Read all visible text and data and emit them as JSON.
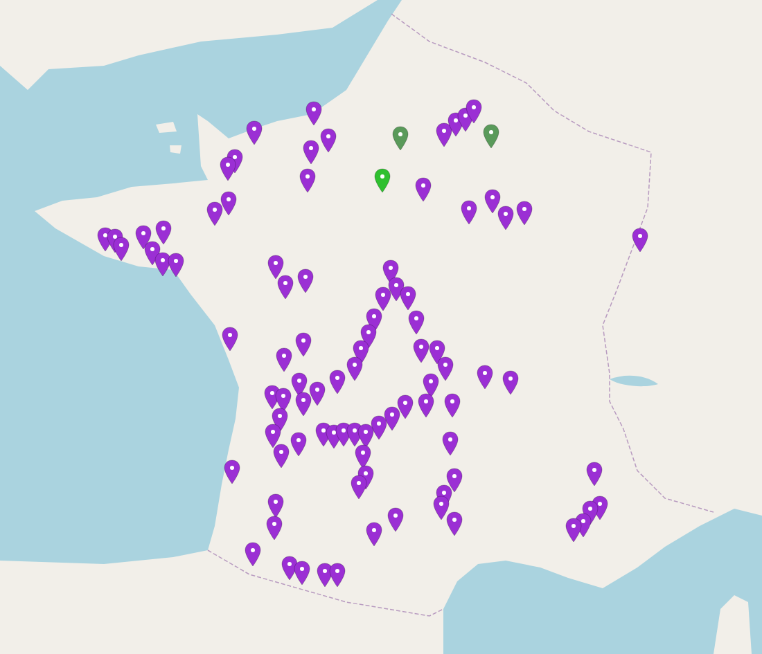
{
  "map": {
    "markers": [
      {
        "color": "#9b2fd4"
      },
      {
        "color": "#9b2fd4"
      },
      {
        "color": "#9b2fd4"
      },
      {
        "color": "#9b2fd4"
      },
      {
        "color": "#9b2fd4"
      },
      {
        "color": "#9b2fd4"
      },
      {
        "color": "#9b2fd4"
      },
      {
        "color": "#9b2fd4"
      },
      {
        "color": "#9b2fd4"
      },
      {
        "color": "#9b2fd4"
      },
      {
        "color": "#9b2fd4"
      },
      {
        "color": "#9b2fd4"
      },
      {
        "color": "#9b2fd4"
      },
      {
        "color": "#9b2fd4"
      },
      {
        "color": "#9b2fd4"
      },
      {
        "color": "#9b2fd4"
      },
      {
        "color": "#9b2fd4"
      },
      {
        "color": "#9b2fd4"
      },
      {
        "color": "#9b2fd4"
      },
      {
        "color": "#9b2fd4"
      },
      {
        "color": "#9b2fd4"
      },
      {
        "color": "#9b2fd4"
      },
      {
        "color": "#9b2fd4"
      },
      {
        "color": "#9b2fd4"
      },
      {
        "color": "#9b2fd4"
      },
      {
        "color": "#9b2fd4"
      },
      {
        "color": "#9b2fd4"
      },
      {
        "color": "#9b2fd4"
      },
      {
        "color": "#9b2fd4"
      },
      {
        "color": "#9b2fd4"
      },
      {
        "color": "#9b2fd4"
      },
      {
        "color": "#9b2fd4"
      },
      {
        "color": "#9b2fd4"
      },
      {
        "color": "#9b2fd4"
      },
      {
        "color": "#9b2fd4"
      },
      {
        "color": "#9b2fd4"
      },
      {
        "color": "#9b2fd4"
      },
      {
        "color": "#9b2fd4"
      },
      {
        "color": "#9b2fd4"
      },
      {
        "color": "#9b2fd4"
      },
      {
        "color": "#9b2fd4"
      },
      {
        "color": "#9b2fd4"
      },
      {
        "color": "#9b2fd4"
      },
      {
        "color": "#9b2fd4"
      },
      {
        "color": "#9b2fd4"
      },
      {
        "color": "#9b2fd4"
      },
      {
        "color": "#9b2fd4"
      },
      {
        "color": "#9b2fd4"
      },
      {
        "color": "#9b2fd4"
      },
      {
        "color": "#9b2fd4"
      },
      {
        "color": "#9b2fd4"
      },
      {
        "color": "#9b2fd4"
      },
      {
        "color": "#9b2fd4"
      },
      {
        "color": "#9b2fd4"
      },
      {
        "color": "#9b2fd4"
      },
      {
        "color": "#9b2fd4"
      },
      {
        "color": "#9b2fd4"
      },
      {
        "color": "#9b2fd4"
      },
      {
        "color": "#9b2fd4"
      },
      {
        "color": "#9b2fd4"
      },
      {
        "color": "#9b2fd4"
      },
      {
        "color": "#9b2fd4"
      },
      {
        "color": "#9b2fd4"
      },
      {
        "color": "#9b2fd4"
      },
      {
        "color": "#9b2fd4"
      },
      {
        "color": "#9b2fd4"
      },
      {
        "color": "#9b2fd4"
      },
      {
        "color": "#9b2fd4"
      },
      {
        "color": "#9b2fd4"
      },
      {
        "color": "#9b2fd4"
      },
      {
        "color": "#9b2fd4"
      },
      {
        "color": "#9b2fd4"
      },
      {
        "color": "#9b2fd4"
      },
      {
        "color": "#9b2fd4"
      },
      {
        "color": "#9b2fd4"
      },
      {
        "color": "#9b2fd4"
      },
      {
        "color": "#9b2fd4"
      },
      {
        "color": "#9b2fd4"
      },
      {
        "color": "#9b2fd4"
      },
      {
        "color": "#9b2fd4"
      },
      {
        "color": "#9b2fd4"
      },
      {
        "color": "#9b2fd4"
      },
      {
        "color": "#9b2fd4"
      },
      {
        "color": "#9b2fd4"
      },
      {
        "color": "#9b2fd4"
      },
      {
        "color": "#9b2fd4"
      },
      {
        "color": "#9b2fd4"
      },
      {
        "color": "#9b2fd4"
      },
      {
        "color": "#9b2fd4"
      },
      {
        "color": "#9b2fd4"
      },
      {
        "color": "#9b2fd4"
      },
      {
        "color": "#5a9a5a"
      },
      {
        "color": "#5a9a5a"
      },
      {
        "color": "#2fc02f"
      }
    ]
  }
}
